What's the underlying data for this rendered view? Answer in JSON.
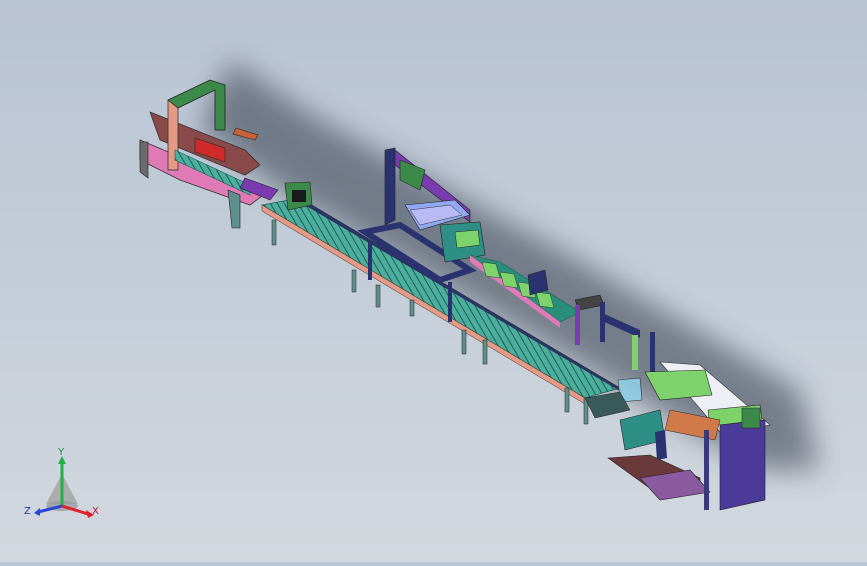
{
  "triad": {
    "x_label": "X",
    "y_label": "Y",
    "z_label": "Z",
    "x_color": "#e0202a",
    "y_color": "#22b04a",
    "z_color": "#2a45d8"
  },
  "model": {
    "palette": {
      "conveyor": "#3a9f8f",
      "frame_pink": "#e07ab6",
      "frame_navy": "#2b3270",
      "frame_green": "#3c8a4a",
      "frame_purple": "#7a3bb0",
      "legs": "#5f8f8a",
      "salmon": "#e69a86",
      "cabinet": "#4b3a9a",
      "lime": "#7ed26b",
      "lightblue": "#8fd0e8"
    }
  }
}
